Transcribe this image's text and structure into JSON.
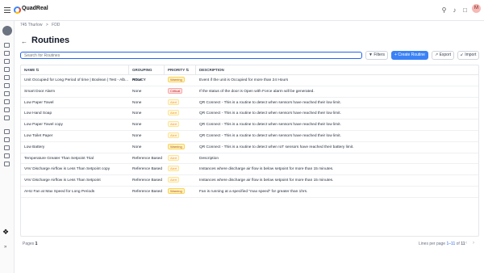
{
  "app": {
    "brand": "QuadReal",
    "avatar_letter": "M"
  },
  "topbar_icons": [
    "search-icon",
    "bell-icon",
    "chat-icon",
    "grid-icon"
  ],
  "breadcrumb": [
    "745 Thurlow",
    ">",
    "FDD"
  ],
  "page": {
    "title": "Routines"
  },
  "search": {
    "placeholder": "Search for Routines"
  },
  "toolbar": {
    "filters_label": "Filters",
    "create_label": "+ Create Routine",
    "export_label": "Export",
    "import_label": "Import"
  },
  "table": {
    "columns": [
      "NAME",
      "GROUPING POLICY",
      "PRIORITY",
      "DESCRIPTION"
    ],
    "rows": [
      {
        "name": "Unit Occupied for Long Period of time | Boolean | Test - Alb...",
        "policy": "None",
        "priority": "Warning",
        "priority_kind": "warn",
        "description": "Event if the unit is Occupied for more than 24 Hours"
      },
      {
        "name": "Smart Door Alarm",
        "policy": "None",
        "priority": "Critical",
        "priority_kind": "crit",
        "description": "If the status of the door is Open with Force alarm will be generated."
      },
      {
        "name": "Low Paper Towel",
        "policy": "None",
        "priority": "Alert",
        "priority_kind": "alert",
        "description": "QR Connect - This is a routine to detect when sensors have reached their low limit."
      },
      {
        "name": "Low Hand Soap",
        "policy": "None",
        "priority": "Alert",
        "priority_kind": "alert",
        "description": "QR Connect - This is a routine to detect when sensors have reached their low limit."
      },
      {
        "name": "Low Paper Towel copy",
        "policy": "None",
        "priority": "Alert",
        "priority_kind": "alert",
        "description": "QR Connect - This is a routine to detect when sensors have reached their low limit."
      },
      {
        "name": "Low Toilet Paper",
        "policy": "None",
        "priority": "Alert",
        "priority_kind": "alert",
        "description": "QR Connect - This is a routine to detect when sensors have reached their low limit."
      },
      {
        "name": "Low Battery",
        "policy": "None",
        "priority": "Warning",
        "priority_kind": "warn",
        "description": "QR Connect - This is a routine to detect when IoT sensors have reached their battery limit."
      },
      {
        "name": "Temperature Greater Than Setpoint Trial",
        "policy": "Reference Based",
        "priority": "Alert",
        "priority_kind": "alert",
        "description": "Description"
      },
      {
        "name": "VAV Discharge Airflow is Less Than Setpoint copy",
        "policy": "Reference Based",
        "priority": "Alert",
        "priority_kind": "alert",
        "description": "Instances where discharge air flow is below setpoint for more than 15 minutes."
      },
      {
        "name": "VAV Discharge Airflow is Less Than Setpoint",
        "policy": "Reference Based",
        "priority": "Alert",
        "priority_kind": "alert",
        "description": "Instances where discharge air flow is below setpoint for more than 15 minutes."
      },
      {
        "name": "AHU Fan at Max Speed for Long Periods",
        "policy": "Reference Based",
        "priority": "Warning",
        "priority_kind": "warn",
        "description": "Fan is running at a specified \"max speed\" for greater than 1hrs."
      }
    ]
  },
  "footer": {
    "pages_label": "Pages",
    "pages_value": "1",
    "lines_label": "Lines per page",
    "lines_range": "1–11",
    "lines_of": "of",
    "lines_total": "11",
    "prev": "‹",
    "next": "›"
  },
  "colors": {
    "accent": "#3b82f6",
    "critical": "#b91c1c",
    "warning": "#b45309",
    "alert": "#f59e0b"
  }
}
